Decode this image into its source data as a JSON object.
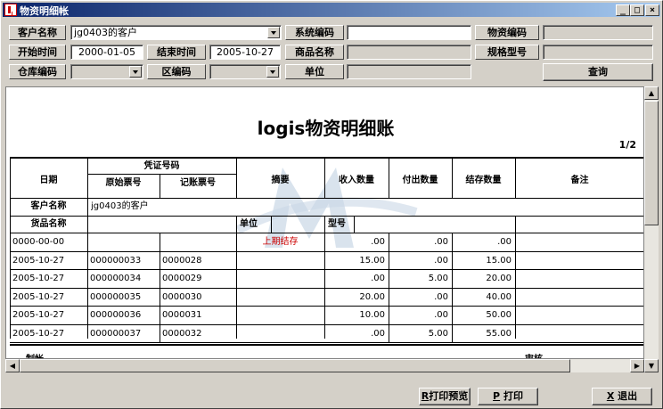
{
  "window": {
    "title": "物资明细帐"
  },
  "titlebar_buttons": {
    "minimize": "_",
    "maximize": "□",
    "close": "×"
  },
  "filters": {
    "customer_name_label": "客户名称",
    "customer_name_value": "jg0403的客户",
    "system_code_label": "系统编码",
    "system_code_value": "",
    "material_code_label": "物资编码",
    "material_code_value": "",
    "start_time_label": "开始时间",
    "start_time_value": "2000-01-05",
    "end_time_label": "结束时间",
    "end_time_value": "2005-10-27",
    "product_name_label": "商品名称",
    "product_name_value": "",
    "spec_model_label": "规格型号",
    "spec_model_value": "",
    "warehouse_code_label": "仓库编码",
    "warehouse_code_value": "",
    "zone_code_label": "区编码",
    "zone_code_value": "",
    "unit_label": "单位",
    "unit_value": "",
    "query_button": "查询"
  },
  "report": {
    "title": "logis物资明细账",
    "page": "1/2",
    "headers": {
      "date": "日期",
      "voucher_no": "凭证号码",
      "original_no": "原始票号",
      "record_no": "记账票号",
      "summary": "摘要",
      "in_qty": "收入数量",
      "out_qty": "付出数量",
      "balance_qty": "结存数量",
      "remark": "备注"
    },
    "customer_label": "客户名称",
    "customer_value": "jg0403的客户",
    "goods_label": "货品名称",
    "unit_label": "单位",
    "model_label": "型号",
    "rows": [
      {
        "date": "0000-00-00",
        "orig": "",
        "rec": "",
        "summary": "上期结存",
        "in": ".00",
        "out": ".00",
        "bal": ".00"
      },
      {
        "date": "2005-10-27",
        "orig": "000000033",
        "rec": "0000028",
        "summary": "",
        "in": "15.00",
        "out": ".00",
        "bal": "15.00"
      },
      {
        "date": "2005-10-27",
        "orig": "000000034",
        "rec": "0000029",
        "summary": "",
        "in": ".00",
        "out": "5.00",
        "bal": "20.00"
      },
      {
        "date": "2005-10-27",
        "orig": "000000035",
        "rec": "0000030",
        "summary": "",
        "in": "20.00",
        "out": ".00",
        "bal": "40.00"
      },
      {
        "date": "2005-10-27",
        "orig": "000000036",
        "rec": "0000031",
        "summary": "",
        "in": "10.00",
        "out": ".00",
        "bal": "50.00"
      },
      {
        "date": "2005-10-27",
        "orig": "000000037",
        "rec": "0000032",
        "summary": "",
        "in": ".00",
        "out": "5.00",
        "bal": "55.00"
      }
    ],
    "footer_maker": "制帐",
    "footer_auditor": "审核",
    "summary_color": "#cc0000"
  },
  "bottom_buttons": {
    "print_preview_key": "R",
    "print_preview": "打印预览",
    "print_key": "P",
    "print": "打印",
    "exit_key": "X",
    "exit": "退出"
  },
  "scrollbar": {
    "up": "▲",
    "down": "▼",
    "left": "◀",
    "right": "▶"
  }
}
